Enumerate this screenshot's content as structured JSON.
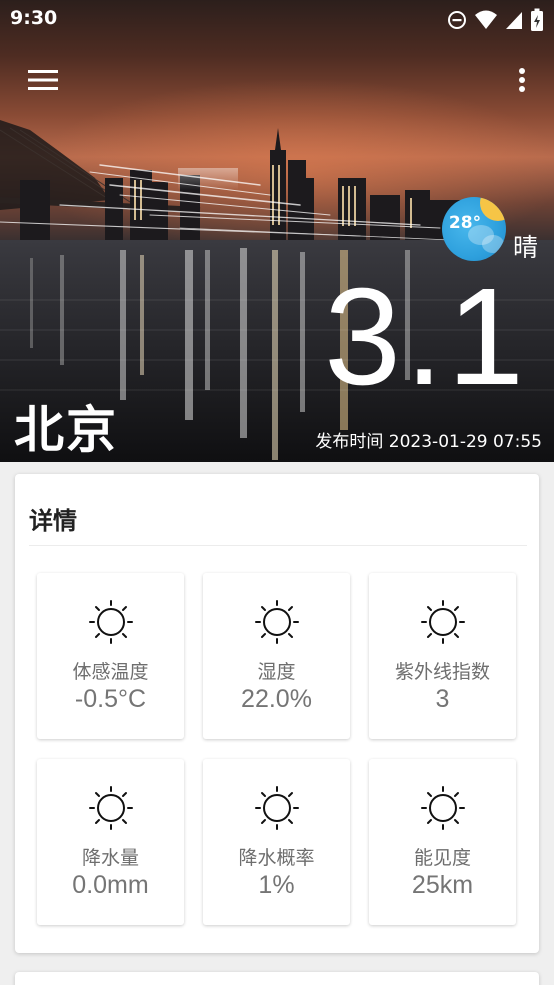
{
  "status_bar": {
    "time": "9:30",
    "icons": [
      "do-not-disturb-icon",
      "wifi-icon",
      "cell-signal-icon",
      "battery-charging-icon"
    ]
  },
  "app_bar": {
    "menu_icon": "menu-icon",
    "more_icon": "more-vert-icon"
  },
  "current": {
    "temp_badge": "28°",
    "weather": "晴",
    "temperature": "3.1",
    "city": "北京",
    "publish_time": "发布时间 2023-01-29 07:55"
  },
  "details": {
    "title": "详情",
    "items": [
      {
        "icon": "sun-icon",
        "label": "体感温度",
        "value": "-0.5°C"
      },
      {
        "icon": "sun-icon",
        "label": "湿度",
        "value": "22.0%"
      },
      {
        "icon": "sun-icon",
        "label": "紫外线指数",
        "value": "3"
      },
      {
        "icon": "sun-icon",
        "label": "降水量",
        "value": "0.0mm"
      },
      {
        "icon": "sun-icon",
        "label": "降水概率",
        "value": "1%"
      },
      {
        "icon": "sun-icon",
        "label": "能见度",
        "value": "25km"
      }
    ]
  },
  "colors": {
    "badge_blue": "#2ea0dd",
    "badge_sun": "#f6c546",
    "value_text": "#757575"
  }
}
